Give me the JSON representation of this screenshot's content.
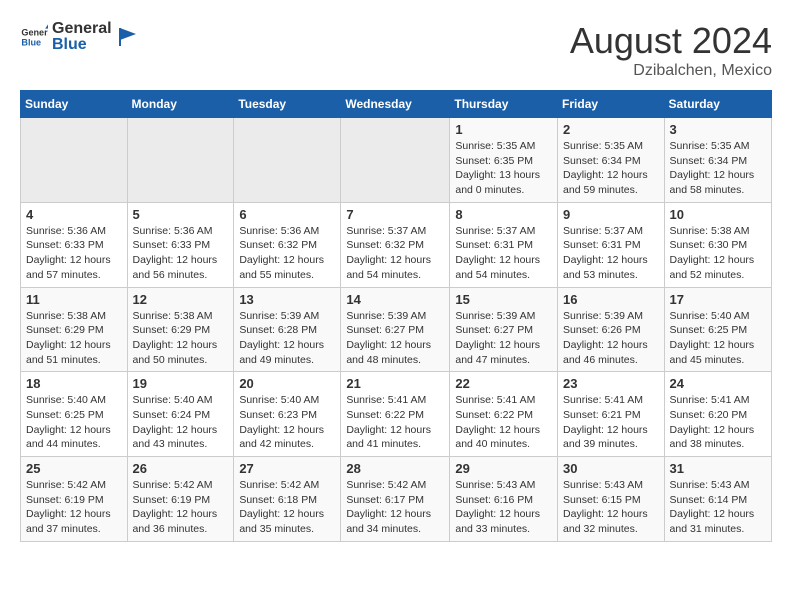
{
  "header": {
    "logo_general": "General",
    "logo_blue": "Blue",
    "month_year": "August 2024",
    "location": "Dzibalchen, Mexico"
  },
  "days_of_week": [
    "Sunday",
    "Monday",
    "Tuesday",
    "Wednesday",
    "Thursday",
    "Friday",
    "Saturday"
  ],
  "weeks": [
    [
      {
        "day": "",
        "info": ""
      },
      {
        "day": "",
        "info": ""
      },
      {
        "day": "",
        "info": ""
      },
      {
        "day": "",
        "info": ""
      },
      {
        "day": "1",
        "info": "Sunrise: 5:35 AM\nSunset: 6:35 PM\nDaylight: 13 hours\nand 0 minutes."
      },
      {
        "day": "2",
        "info": "Sunrise: 5:35 AM\nSunset: 6:34 PM\nDaylight: 12 hours\nand 59 minutes."
      },
      {
        "day": "3",
        "info": "Sunrise: 5:35 AM\nSunset: 6:34 PM\nDaylight: 12 hours\nand 58 minutes."
      }
    ],
    [
      {
        "day": "4",
        "info": "Sunrise: 5:36 AM\nSunset: 6:33 PM\nDaylight: 12 hours\nand 57 minutes."
      },
      {
        "day": "5",
        "info": "Sunrise: 5:36 AM\nSunset: 6:33 PM\nDaylight: 12 hours\nand 56 minutes."
      },
      {
        "day": "6",
        "info": "Sunrise: 5:36 AM\nSunset: 6:32 PM\nDaylight: 12 hours\nand 55 minutes."
      },
      {
        "day": "7",
        "info": "Sunrise: 5:37 AM\nSunset: 6:32 PM\nDaylight: 12 hours\nand 54 minutes."
      },
      {
        "day": "8",
        "info": "Sunrise: 5:37 AM\nSunset: 6:31 PM\nDaylight: 12 hours\nand 54 minutes."
      },
      {
        "day": "9",
        "info": "Sunrise: 5:37 AM\nSunset: 6:31 PM\nDaylight: 12 hours\nand 53 minutes."
      },
      {
        "day": "10",
        "info": "Sunrise: 5:38 AM\nSunset: 6:30 PM\nDaylight: 12 hours\nand 52 minutes."
      }
    ],
    [
      {
        "day": "11",
        "info": "Sunrise: 5:38 AM\nSunset: 6:29 PM\nDaylight: 12 hours\nand 51 minutes."
      },
      {
        "day": "12",
        "info": "Sunrise: 5:38 AM\nSunset: 6:29 PM\nDaylight: 12 hours\nand 50 minutes."
      },
      {
        "day": "13",
        "info": "Sunrise: 5:39 AM\nSunset: 6:28 PM\nDaylight: 12 hours\nand 49 minutes."
      },
      {
        "day": "14",
        "info": "Sunrise: 5:39 AM\nSunset: 6:27 PM\nDaylight: 12 hours\nand 48 minutes."
      },
      {
        "day": "15",
        "info": "Sunrise: 5:39 AM\nSunset: 6:27 PM\nDaylight: 12 hours\nand 47 minutes."
      },
      {
        "day": "16",
        "info": "Sunrise: 5:39 AM\nSunset: 6:26 PM\nDaylight: 12 hours\nand 46 minutes."
      },
      {
        "day": "17",
        "info": "Sunrise: 5:40 AM\nSunset: 6:25 PM\nDaylight: 12 hours\nand 45 minutes."
      }
    ],
    [
      {
        "day": "18",
        "info": "Sunrise: 5:40 AM\nSunset: 6:25 PM\nDaylight: 12 hours\nand 44 minutes."
      },
      {
        "day": "19",
        "info": "Sunrise: 5:40 AM\nSunset: 6:24 PM\nDaylight: 12 hours\nand 43 minutes."
      },
      {
        "day": "20",
        "info": "Sunrise: 5:40 AM\nSunset: 6:23 PM\nDaylight: 12 hours\nand 42 minutes."
      },
      {
        "day": "21",
        "info": "Sunrise: 5:41 AM\nSunset: 6:22 PM\nDaylight: 12 hours\nand 41 minutes."
      },
      {
        "day": "22",
        "info": "Sunrise: 5:41 AM\nSunset: 6:22 PM\nDaylight: 12 hours\nand 40 minutes."
      },
      {
        "day": "23",
        "info": "Sunrise: 5:41 AM\nSunset: 6:21 PM\nDaylight: 12 hours\nand 39 minutes."
      },
      {
        "day": "24",
        "info": "Sunrise: 5:41 AM\nSunset: 6:20 PM\nDaylight: 12 hours\nand 38 minutes."
      }
    ],
    [
      {
        "day": "25",
        "info": "Sunrise: 5:42 AM\nSunset: 6:19 PM\nDaylight: 12 hours\nand 37 minutes."
      },
      {
        "day": "26",
        "info": "Sunrise: 5:42 AM\nSunset: 6:19 PM\nDaylight: 12 hours\nand 36 minutes."
      },
      {
        "day": "27",
        "info": "Sunrise: 5:42 AM\nSunset: 6:18 PM\nDaylight: 12 hours\nand 35 minutes."
      },
      {
        "day": "28",
        "info": "Sunrise: 5:42 AM\nSunset: 6:17 PM\nDaylight: 12 hours\nand 34 minutes."
      },
      {
        "day": "29",
        "info": "Sunrise: 5:43 AM\nSunset: 6:16 PM\nDaylight: 12 hours\nand 33 minutes."
      },
      {
        "day": "30",
        "info": "Sunrise: 5:43 AM\nSunset: 6:15 PM\nDaylight: 12 hours\nand 32 minutes."
      },
      {
        "day": "31",
        "info": "Sunrise: 5:43 AM\nSunset: 6:14 PM\nDaylight: 12 hours\nand 31 minutes."
      }
    ]
  ]
}
